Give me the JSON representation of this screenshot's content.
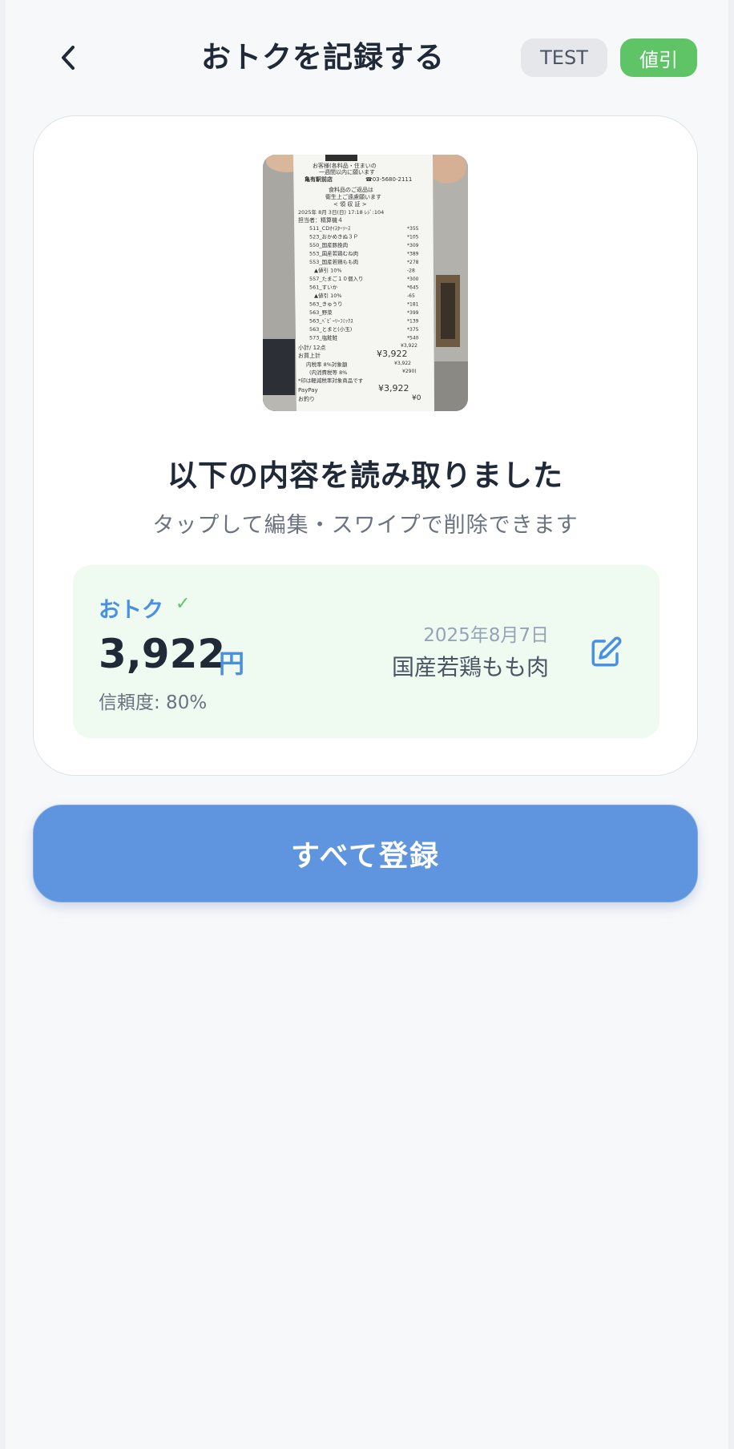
{
  "header": {
    "title": "おトクを記録する",
    "test_label": "TEST",
    "discount_label": "値引"
  },
  "scan": {
    "heading": "以下の内容を読み取りました",
    "subheading": "タップして編集・スワイプで削除できます"
  },
  "result": {
    "type_label": "おトク",
    "check_mark": "✓",
    "amount": "3,922",
    "currency": "円",
    "confidence": "信頼度: 80%",
    "date": "2025年8月7日",
    "item": "国産若鶏もも肉"
  },
  "receipt": {
    "store_phone": "☎03-5680-2111",
    "store": "亀有駅前店",
    "notice1": "食料品のご返品は",
    "notice2": "衛生上ご遠慮願います",
    "doc_title": "< 領 収 証 >",
    "datetime": "2025年 8月 3日(日) 17:18 ﾚｼﾞ:104",
    "staff": "担当者：精算機４",
    "lines": [
      {
        "name": "511_CDｵｲｽﾀｰｿｰｽ",
        "price": "*355"
      },
      {
        "name": "523_おかめきぬ３Ｐ",
        "price": "*105"
      },
      {
        "name": "550_国産豚挽肉",
        "price": "*309"
      },
      {
        "name": "553_国産若鶏むね肉",
        "price": "*389"
      },
      {
        "name": "553_国産若鶏もも肉",
        "price": "*278"
      },
      {
        "name": "▲値引 10%",
        "price": "-28"
      },
      {
        "name": "557_たまご１０個入り",
        "price": "*300"
      },
      {
        "name": "561_すいか",
        "price": "*645"
      },
      {
        "name": "▲値引 10%",
        "price": "-65"
      },
      {
        "name": "563_きゅうり",
        "price": "*181"
      },
      {
        "name": "563_野菜",
        "price": "*399"
      },
      {
        "name": "563_ﾍﾞﾋﾞｰﾘｰﾌﾐｯｸｽ",
        "price": "*139"
      },
      {
        "name": "563_とまと(小玉)",
        "price": "*375"
      },
      {
        "name": "573_塩鮭鮭",
        "price": "*540"
      }
    ],
    "subtotal_label": "小計/ 12点",
    "subtotal": "¥3,922",
    "total_label": "お買上計",
    "total": "¥3,922",
    "tax_label": "内税率 8%対象額",
    "tax_base": "¥3,922",
    "tax_inner_label": "(内消費税等 8%",
    "tax_inner": "¥290)",
    "reduced_note": "*印は軽減税率対象商品です",
    "pay_label": "PayPay",
    "pay": "¥3,922",
    "change_label": "お釣り",
    "change": "¥0"
  },
  "actions": {
    "register_all": "すべて登録"
  },
  "colors": {
    "accent": "#4a90e2",
    "success": "#5ec466",
    "button": "#5f95df",
    "result_bg": "#effbf1"
  },
  "icons": {
    "back": "chevron-left-icon",
    "edit": "edit-icon",
    "check": "check-icon"
  }
}
